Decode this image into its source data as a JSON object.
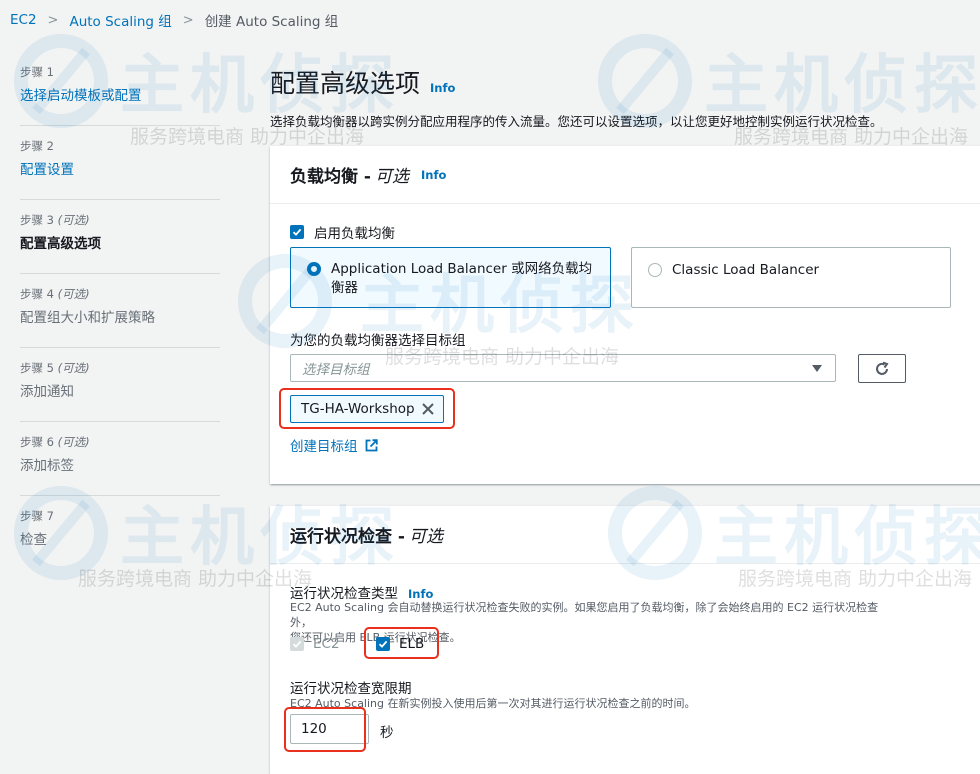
{
  "breadcrumb": {
    "items": [
      {
        "label": "EC2"
      },
      {
        "label": "Auto Scaling 组"
      },
      {
        "label": "创建 Auto Scaling 组"
      }
    ]
  },
  "steps": [
    {
      "label": "步骤 1",
      "optional": "",
      "title": "选择启动模板或配置"
    },
    {
      "label": "步骤 2",
      "optional": "",
      "title": "配置设置"
    },
    {
      "label": "步骤 3",
      "optional": "(可选)",
      "title": "配置高级选项"
    },
    {
      "label": "步骤 4",
      "optional": "(可选)",
      "title": "配置组大小和扩展策略"
    },
    {
      "label": "步骤 5",
      "optional": "(可选)",
      "title": "添加通知"
    },
    {
      "label": "步骤 6",
      "optional": "(可选)",
      "title": "添加标签"
    },
    {
      "label": "步骤 7",
      "optional": "",
      "title": "检查"
    }
  ],
  "page": {
    "title": "配置高级选项",
    "info": "Info",
    "description": "选择负载均衡器以跨实例分配应用程序的传入流量。您还可以设置选项，以让您更好地控制实例运行状况检查。"
  },
  "load_balancing": {
    "title": "负载均衡 -",
    "optional": "可选",
    "info": "Info",
    "enable_label": "启用负载均衡",
    "alb_label": "Application Load Balancer 或网络负载均衡器",
    "clb_label": "Classic Load Balancer",
    "target_group_label": "为您的负载均衡器选择目标组",
    "target_group_placeholder": "选择目标组",
    "selected_target_group": "TG-HA-Workshop",
    "create_target_group": "创建目标组"
  },
  "health_check": {
    "title": "运行状况检查 -",
    "optional": "可选",
    "type_label": "运行状况检查类型",
    "info": "Info",
    "type_desc_line1": "EC2 Auto Scaling 会自动替换运行状况检查失败的实例。如果您启用了负载均衡，除了会始终启用的 EC2 运行状况检查外，",
    "type_desc_line2": "您还可以启用 ELB 运行状况检查。",
    "ec2_label": "EC2",
    "elb_label": "ELB",
    "grace_label": "运行状况检查宽限期",
    "grace_desc": "EC2 Auto Scaling 在新实例投入使用后第一次对其进行运行状况检查之前的时间。",
    "grace_value": "120",
    "grace_unit": "秒"
  },
  "watermark": {
    "title": "主机侦探",
    "subtitle": "服务跨境电商  助力中企出海"
  },
  "colors": {
    "link": "#0073bb",
    "highlight": "#e8301c",
    "background": "#f2f3f3"
  }
}
